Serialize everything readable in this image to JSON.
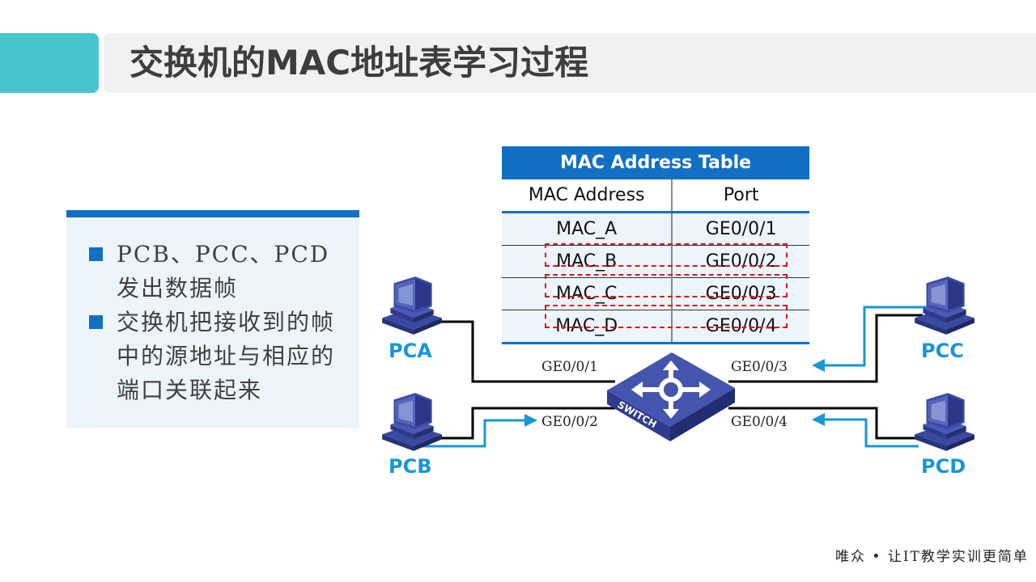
{
  "header": {
    "title": "交换机的MAC地址表学习过程",
    "accent_color": "#48c4cc"
  },
  "info_panel": {
    "bullets": [
      "PCB、PCC、PCD发出数据帧",
      "交换机把接收到的帧中的源地址与相应的端口关联起来"
    ],
    "accent_color": "#1270c4"
  },
  "mac_table": {
    "caption": "MAC Address Table",
    "columns": [
      "MAC Address",
      "Port"
    ],
    "rows": [
      {
        "mac": "MAC_A",
        "port": "GE0/0/1",
        "highlighted": false
      },
      {
        "mac": "MAC_B",
        "port": "GE0/0/2",
        "highlighted": true
      },
      {
        "mac": "MAC_C",
        "port": "GE0/0/3",
        "highlighted": true
      },
      {
        "mac": "MAC_D",
        "port": "GE0/0/4",
        "highlighted": true
      }
    ],
    "highlight_color": "#e21515"
  },
  "diagram": {
    "switch_label": "SWITCH",
    "hosts": [
      {
        "name": "PCA",
        "port": "GE0/0/1",
        "sending": false
      },
      {
        "name": "PCB",
        "port": "GE0/0/2",
        "sending": true
      },
      {
        "name": "PCC",
        "port": "GE0/0/3",
        "sending": true
      },
      {
        "name": "PCD",
        "port": "GE0/0/4",
        "sending": true
      }
    ],
    "link_color": "#000000",
    "flow_color": "#1896d6",
    "host_label_color": "#1896d6"
  },
  "footer": {
    "slogan": "唯众 • 让IT教学实训更简单"
  }
}
